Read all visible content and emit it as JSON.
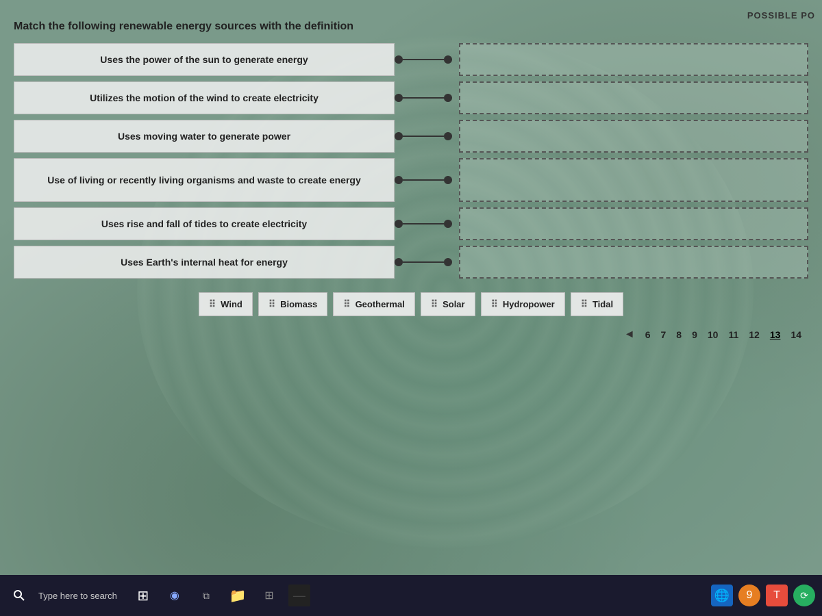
{
  "header": {
    "top_right": "POSSIBLE PO",
    "question_title": "Match the following renewable energy sources with the definition"
  },
  "definitions": [
    {
      "id": "def1",
      "text": "Uses the power of the sun to generate energy"
    },
    {
      "id": "def2",
      "text": "Utilizes the motion of the wind to create electricity"
    },
    {
      "id": "def3",
      "text": "Uses moving water to generate power"
    },
    {
      "id": "def4",
      "text": "Use of living or recently living organisms and waste to create energy"
    },
    {
      "id": "def5",
      "text": "Uses rise and fall of tides to create electricity"
    },
    {
      "id": "def6",
      "text": "Uses Earth's internal heat for energy"
    }
  ],
  "drag_items": [
    {
      "id": "wind",
      "label": "Wind"
    },
    {
      "id": "biomass",
      "label": "Biomass"
    },
    {
      "id": "geothermal",
      "label": "Geothermal"
    },
    {
      "id": "solar",
      "label": "Solar"
    },
    {
      "id": "hydropower",
      "label": "Hydropower"
    },
    {
      "id": "tidal",
      "label": "Tidal"
    }
  ],
  "pagination": {
    "arrow_left": "◄",
    "pages": [
      "6",
      "7",
      "8",
      "9",
      "10",
      "11",
      "12",
      "13",
      "14"
    ],
    "active_page": "13"
  },
  "taskbar": {
    "search_placeholder": "Type here to search"
  }
}
